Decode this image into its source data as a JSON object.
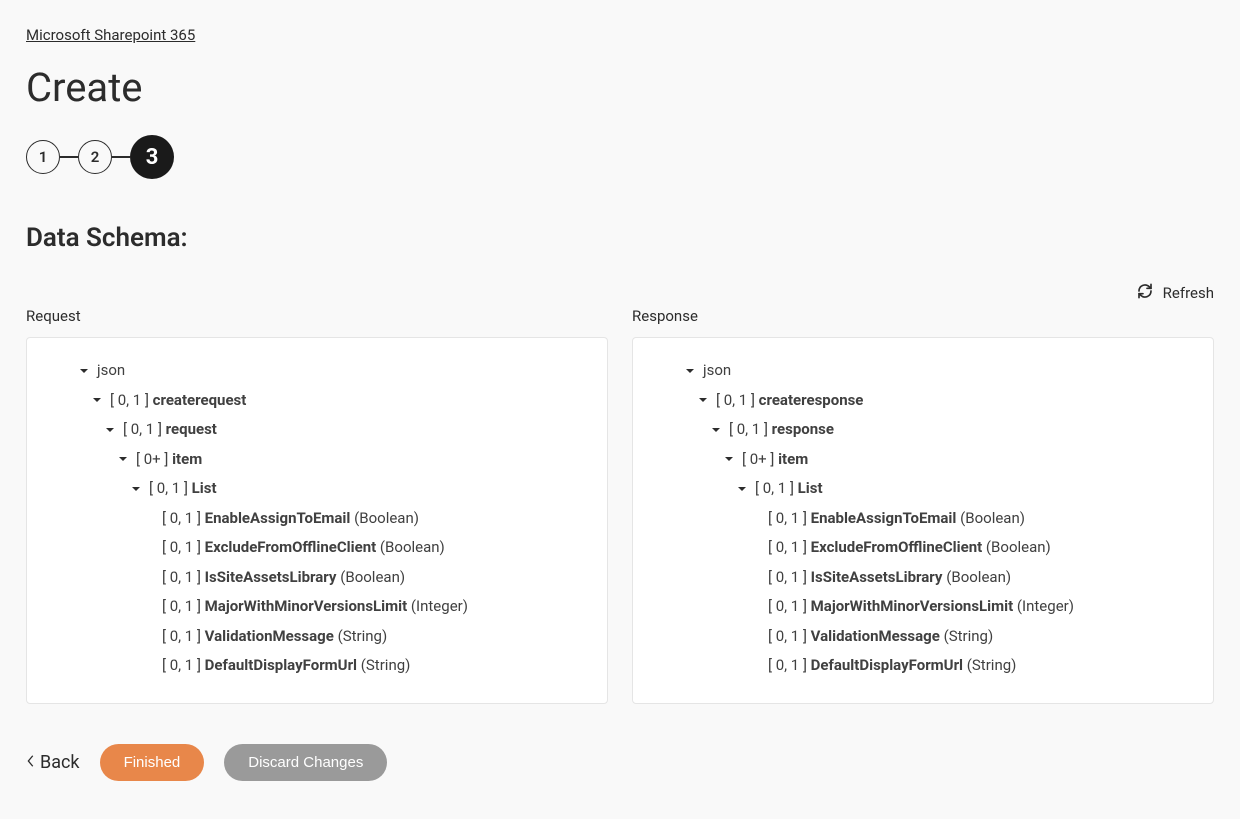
{
  "breadcrumb": "Microsoft Sharepoint 365",
  "page_title": "Create",
  "stepper": {
    "steps": [
      "1",
      "2",
      "3"
    ],
    "active_index": 2
  },
  "section_heading": "Data Schema:",
  "refresh_label": "Refresh",
  "columns": {
    "request": {
      "heading": "Request",
      "tree": {
        "root": "json",
        "node1": {
          "card": "[ 0, 1 ]",
          "name": "createrequest"
        },
        "node2": {
          "card": "[ 0, 1 ]",
          "name": "request"
        },
        "node3": {
          "card": "[ 0+ ]",
          "name": "item"
        },
        "node4": {
          "card": "[ 0, 1 ]",
          "name": "List"
        },
        "leaves": [
          {
            "card": "[ 0, 1 ]",
            "name": "EnableAssignToEmail",
            "type": "(Boolean)"
          },
          {
            "card": "[ 0, 1 ]",
            "name": "ExcludeFromOfflineClient",
            "type": "(Boolean)"
          },
          {
            "card": "[ 0, 1 ]",
            "name": "IsSiteAssetsLibrary",
            "type": "(Boolean)"
          },
          {
            "card": "[ 0, 1 ]",
            "name": "MajorWithMinorVersionsLimit",
            "type": "(Integer)"
          },
          {
            "card": "[ 0, 1 ]",
            "name": "ValidationMessage",
            "type": "(String)"
          },
          {
            "card": "[ 0, 1 ]",
            "name": "DefaultDisplayFormUrl",
            "type": "(String)"
          }
        ]
      }
    },
    "response": {
      "heading": "Response",
      "tree": {
        "root": "json",
        "node1": {
          "card": "[ 0, 1 ]",
          "name": "createresponse"
        },
        "node2": {
          "card": "[ 0, 1 ]",
          "name": "response"
        },
        "node3": {
          "card": "[ 0+ ]",
          "name": "item"
        },
        "node4": {
          "card": "[ 0, 1 ]",
          "name": "List"
        },
        "leaves": [
          {
            "card": "[ 0, 1 ]",
            "name": "EnableAssignToEmail",
            "type": "(Boolean)"
          },
          {
            "card": "[ 0, 1 ]",
            "name": "ExcludeFromOfflineClient",
            "type": "(Boolean)"
          },
          {
            "card": "[ 0, 1 ]",
            "name": "IsSiteAssetsLibrary",
            "type": "(Boolean)"
          },
          {
            "card": "[ 0, 1 ]",
            "name": "MajorWithMinorVersionsLimit",
            "type": "(Integer)"
          },
          {
            "card": "[ 0, 1 ]",
            "name": "ValidationMessage",
            "type": "(String)"
          },
          {
            "card": "[ 0, 1 ]",
            "name": "DefaultDisplayFormUrl",
            "type": "(String)"
          }
        ]
      }
    }
  },
  "footer": {
    "back": "Back",
    "finished": "Finished",
    "discard": "Discard Changes"
  }
}
